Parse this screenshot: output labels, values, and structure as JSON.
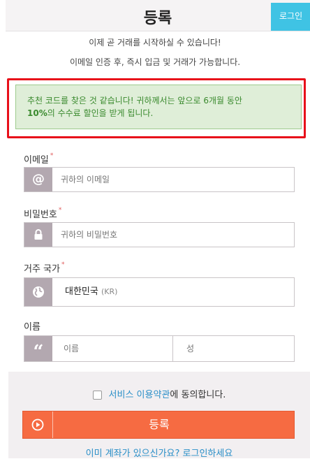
{
  "header": {
    "title": "등록",
    "login_tab": "로그인"
  },
  "intro": {
    "line1": "이제 곧 거래를 시작하실 수 있습니다!",
    "line2": "이메일 인증 후, 즉시 입금 및 거래가 가능합니다."
  },
  "promo": {
    "line1": "추천 코드를 찾은 것 같습니다! 귀하께서는 앞으로 6개월 동안",
    "bold": "10%",
    "line2_rest": "의 수수료 할인을 받게 됩니다."
  },
  "form": {
    "email": {
      "label": "이메일",
      "required": "*",
      "placeholder": "귀하의 이메일",
      "icon": "at-icon"
    },
    "password": {
      "label": "비밀번호",
      "required": "*",
      "placeholder": "귀하의 비밀번호",
      "icon": "lock-icon"
    },
    "country": {
      "label": "거주 국가",
      "required": "*",
      "value": "대한민국",
      "code": "(KR)",
      "icon": "globe-icon"
    },
    "name": {
      "label": "이름",
      "first_placeholder": "이름",
      "last_placeholder": "성",
      "icon": "quote-icon"
    }
  },
  "footer": {
    "terms_link": "서비스 이용약관",
    "terms_rest": "에 동의합니다.",
    "register_label": "등록",
    "already": "이미 계좌가 있으신가요? 로그인하세요"
  },
  "colors": {
    "accent": "#f66b42",
    "login_tab": "#3fc3e4",
    "addon": "#b3a8b0",
    "promo_bg": "#dfeed8",
    "promo_text": "#3a8a2e",
    "highlight": "#e8101a"
  }
}
